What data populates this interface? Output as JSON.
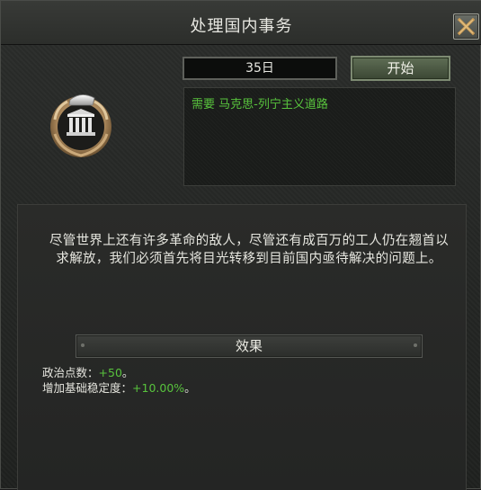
{
  "window": {
    "title": "处理国内事务",
    "close_icon": "close-x-icon"
  },
  "decision": {
    "duration": "35日",
    "start_label": "开始",
    "requirement": "需要 马克思-列宁主义道路",
    "emblem_icon": "government-building-laurel-icon",
    "description": "尽管世界上还有许多革命的敌人，尽管还有成百万的工人仍在翘首以求解放，我们必须首先将目光转移到目前国内亟待解决的问题上。"
  },
  "effects": {
    "header": "效果",
    "items": [
      {
        "label": "政治点数：",
        "value": "+50",
        "suffix": "。"
      },
      {
        "label": "增加基础稳定度：",
        "value": "+10.00%",
        "suffix": "。"
      }
    ]
  },
  "colors": {
    "positive_value": "#58c33d",
    "requirement_text": "#58c33d",
    "panel_bg": "#2a2b29"
  }
}
